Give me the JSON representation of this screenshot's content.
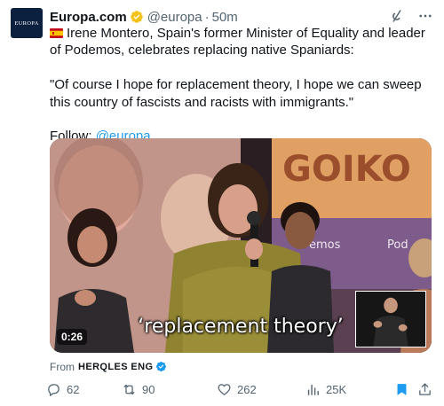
{
  "author": {
    "name": "Europa.com",
    "handle": "@europa",
    "separator": "·",
    "time": "50m",
    "avatar_text": "EUROPA",
    "verified_color": "#f4c21b"
  },
  "tweet": {
    "line1": "Irene Montero, Spain's former Minister of Equality and leader of Podemos, celebrates replacing native Spaniards:",
    "quote": "\"Of course I hope for replacement theory, I hope we can sweep this country of fascists and racists with immigrants.\"",
    "follow_label": "Follow:",
    "follow_handle": "@europa"
  },
  "media": {
    "caption": "‘replacement theory’",
    "duration": "0:26",
    "background_sign_text": "GOIKO",
    "background_banner_text_1": "emos",
    "background_banner_text_2": "Pod"
  },
  "source": {
    "from_label": "From",
    "source_name": "HERQLES ENG"
  },
  "actions": {
    "replies": "62",
    "reposts": "90",
    "likes": "262",
    "views": "25K"
  },
  "icons": {
    "top": [
      "grok-icon",
      "more-options-icon"
    ],
    "actions": [
      "reply-icon",
      "retweet-icon",
      "like-icon",
      "views-icon",
      "bookmark-icon",
      "share-icon"
    ]
  },
  "colors": {
    "accent": "#1d9bf0",
    "muted": "#536471",
    "text": "#0f1419",
    "bookmark_active": "#1d9bf0"
  }
}
